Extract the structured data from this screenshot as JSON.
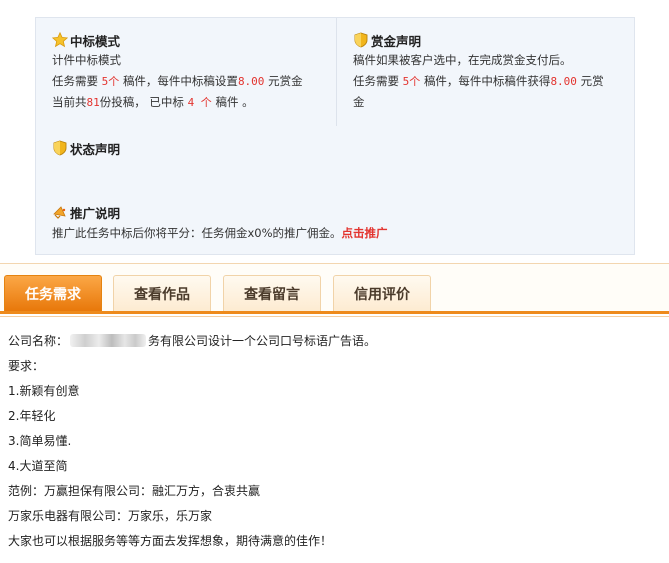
{
  "info_panel": {
    "bid_mode": {
      "title": "中标模式",
      "mode": "计件中标模式",
      "l2_a": "任务需要",
      "l2_count": "5个",
      "l2_b": "稿件，每件中标稿设置",
      "l2_amount": "8.00",
      "l2_c": "元赏金",
      "l3_a": "当前共",
      "l3_total": "81",
      "l3_b": "份投稿，  已中标",
      "l3_won": "4 个",
      "l3_c": "稿件 。"
    },
    "reward_statement": {
      "title": "赏金声明",
      "l1": "稿件如果被客户选中，在完成赏金支付后。",
      "l2_a": "任务需要",
      "l2_count": "5个",
      "l2_b": "稿件，每件中标稿件获得",
      "l2_amount": "8.00",
      "l2_c": "元赏",
      "l3": "金"
    },
    "status_statement": {
      "title": "状态声明"
    },
    "promotion": {
      "title": "推广说明",
      "text": "推广此任务中标后你将平分：任务佣金x0%的推广佣金。",
      "link": "点击推广"
    }
  },
  "tabs": [
    {
      "label": "任务需求",
      "active": true
    },
    {
      "label": "查看作品",
      "active": false
    },
    {
      "label": "查看留言",
      "active": false
    },
    {
      "label": "信用评价",
      "active": false
    }
  ],
  "content": {
    "company_label": "公司名称：",
    "company_suffix": "务有限公司设计一个公司口号标语广告语。",
    "requirements_label": "要求：",
    "items": [
      "1.新颖有创意",
      "2.年轻化",
      "3.简单易懂.",
      "4.大道至简"
    ],
    "example1": "范例：万赢担保有限公司：融汇万方，合衷共赢",
    "example2": "万家乐电器有限公司：万家乐，乐万家",
    "closing": "大家也可以根据服务等等方面去发挥想象，期待满意的佳作！"
  },
  "colors": {
    "accent": "#ee8a1b",
    "highlight": "#e3342f",
    "panel_bg": "#f2f6fb"
  }
}
